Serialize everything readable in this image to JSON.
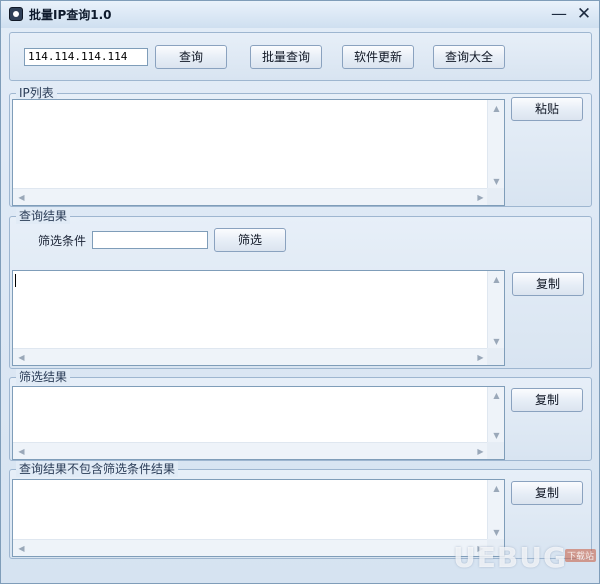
{
  "window": {
    "title": "批量IP查询1.0",
    "min_symbol": "—",
    "close_symbol": "✕"
  },
  "top": {
    "ip_value": "114.114.114.114",
    "query_btn": "查询",
    "batch_btn": "批量查询",
    "update_btn": "软件更新",
    "all_btn": "查询大全"
  },
  "ip_list": {
    "legend": "IP列表",
    "paste_btn": "粘贴"
  },
  "query_results": {
    "legend": "查询结果",
    "filter_label": "筛选条件",
    "filter_value": "",
    "filter_btn": "筛选",
    "copy_btn": "复制"
  },
  "filter_results": {
    "legend": "筛选结果",
    "copy_btn": "复制"
  },
  "excluded_results": {
    "legend": "查询结果不包含筛选条件结果",
    "copy_btn": "复制"
  },
  "watermark": {
    "text": "UEBUG",
    "sub": "下载站"
  }
}
